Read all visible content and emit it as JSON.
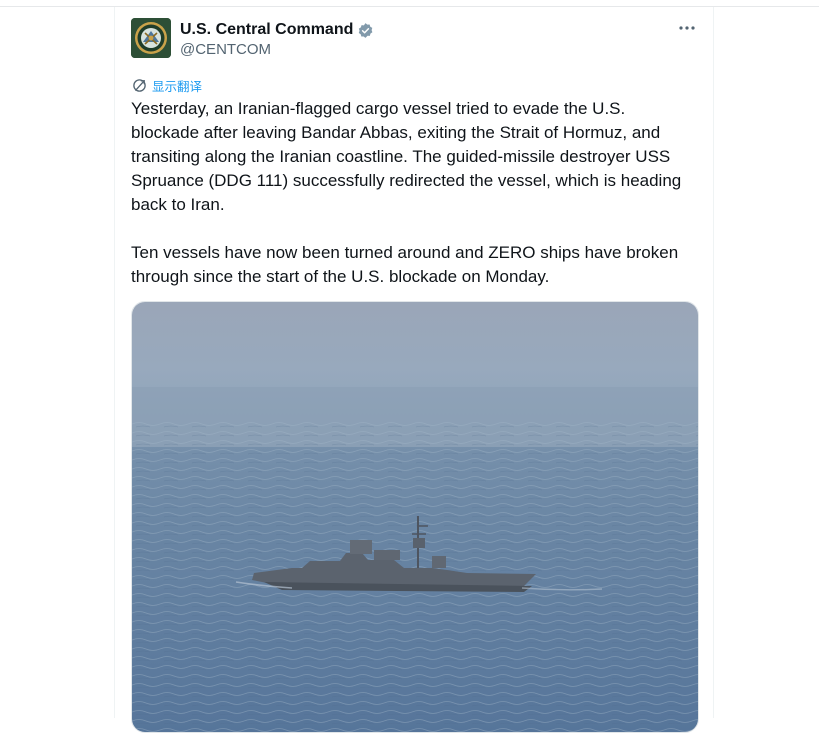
{
  "author": {
    "display_name": "U.S. Central Command",
    "handle": "@CENTCOM",
    "verified": true
  },
  "translate_label": "显示翻译",
  "tweet_text": {
    "paragraph_1": "Yesterday, an Iranian-flagged cargo vessel tried to evade the U.S. blockade after leaving Bandar Abbas, exiting the Strait of Hormuz, and transiting along the Iranian coastline. The guided-missile destroyer USS Spruance (DDG 111) successfully redirected the vessel, which is heading back to Iran.",
    "paragraph_2": "Ten vessels have now been turned around and ZERO ships have broken through since the start of the U.S. blockade on Monday."
  },
  "icons": {
    "more": "more-horizontal-icon",
    "translate": "translate-icon",
    "verified": "verified-badge-icon"
  },
  "colors": {
    "accent": "#1d9bf0",
    "text_primary": "#0f1419",
    "text_secondary": "#536471"
  }
}
